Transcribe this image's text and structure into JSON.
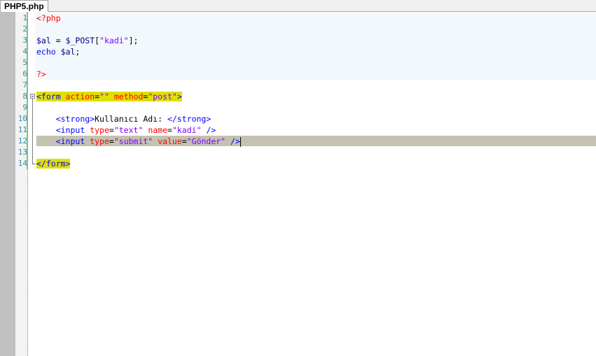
{
  "tab": {
    "label": "PHP5.php"
  },
  "lines": [
    {
      "num": "1",
      "parts": [
        {
          "t": "<?php",
          "c": "php"
        }
      ]
    },
    {
      "num": "2",
      "parts": []
    },
    {
      "num": "3",
      "parts": [
        {
          "t": "$al",
          "c": "var"
        },
        {
          "t": " = ",
          "c": "plain"
        },
        {
          "t": "$_POST",
          "c": "var"
        },
        {
          "t": "[",
          "c": "plain"
        },
        {
          "t": "\"kadi\"",
          "c": "str"
        },
        {
          "t": "];",
          "c": "plain"
        }
      ]
    },
    {
      "num": "4",
      "parts": [
        {
          "t": "echo",
          "c": "kw"
        },
        {
          "t": " ",
          "c": "plain"
        },
        {
          "t": "$al",
          "c": "var"
        },
        {
          "t": ";",
          "c": "plain"
        }
      ]
    },
    {
      "num": "5",
      "parts": []
    },
    {
      "num": "6",
      "parts": [
        {
          "t": "?>",
          "c": "php"
        }
      ]
    },
    {
      "num": "7",
      "parts": []
    },
    {
      "num": "8",
      "parts": [
        {
          "t": "<form",
          "c": "tag",
          "hl": true
        },
        {
          "t": " ",
          "c": "plain",
          "hl": true
        },
        {
          "t": "action",
          "c": "attr",
          "hl": true
        },
        {
          "t": "=",
          "c": "plain",
          "hl": true
        },
        {
          "t": "\"\"",
          "c": "str",
          "hl": true
        },
        {
          "t": " ",
          "c": "plain",
          "hl": true
        },
        {
          "t": "method",
          "c": "attr",
          "hl": true
        },
        {
          "t": "=",
          "c": "plain",
          "hl": true
        },
        {
          "t": "\"post\"",
          "c": "str",
          "hl": true
        },
        {
          "t": ">",
          "c": "tag",
          "hl": true
        }
      ]
    },
    {
      "num": "9",
      "parts": []
    },
    {
      "num": "10",
      "parts": [
        {
          "t": "    ",
          "c": "plain"
        },
        {
          "t": "<strong>",
          "c": "tag"
        },
        {
          "t": "Kullanıcı Adı: ",
          "c": "plain"
        },
        {
          "t": "</strong>",
          "c": "tag"
        }
      ]
    },
    {
      "num": "11",
      "parts": [
        {
          "t": "    ",
          "c": "plain"
        },
        {
          "t": "<input",
          "c": "tag"
        },
        {
          "t": " ",
          "c": "plain"
        },
        {
          "t": "type",
          "c": "attr"
        },
        {
          "t": "=",
          "c": "plain"
        },
        {
          "t": "\"text\"",
          "c": "str"
        },
        {
          "t": " ",
          "c": "plain"
        },
        {
          "t": "name",
          "c": "attr"
        },
        {
          "t": "=",
          "c": "plain"
        },
        {
          "t": "\"kadi\"",
          "c": "str"
        },
        {
          "t": " ",
          "c": "plain"
        },
        {
          "t": "/>",
          "c": "tag"
        }
      ]
    },
    {
      "num": "12",
      "current": true,
      "parts": [
        {
          "t": "    ",
          "c": "plain"
        },
        {
          "t": "<input",
          "c": "tag"
        },
        {
          "t": " ",
          "c": "plain"
        },
        {
          "t": "type",
          "c": "attr"
        },
        {
          "t": "=",
          "c": "plain"
        },
        {
          "t": "\"submit\"",
          "c": "str"
        },
        {
          "t": " ",
          "c": "plain"
        },
        {
          "t": "value",
          "c": "attr"
        },
        {
          "t": "=",
          "c": "plain"
        },
        {
          "t": "\"Gönder\"",
          "c": "str"
        },
        {
          "t": " ",
          "c": "plain"
        },
        {
          "t": "/>",
          "c": "tag"
        }
      ]
    },
    {
      "num": "13",
      "parts": []
    },
    {
      "num": "14",
      "parts": [
        {
          "t": "</form>",
          "c": "tag",
          "hl": true
        }
      ]
    }
  ],
  "colors": {
    "current_line": "#c4c2b0",
    "tag_highlight": "#dfe000",
    "php_block_bg": "#f2f8fb",
    "line_number": "#2b91af"
  }
}
